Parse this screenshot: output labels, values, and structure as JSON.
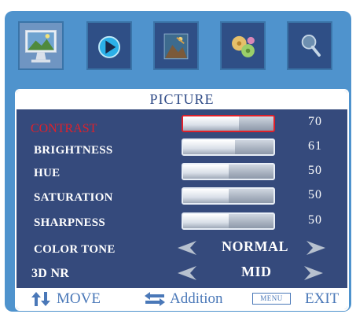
{
  "menu_title": "PICTURE",
  "tabs": [
    {
      "name": "picture-tab-icon"
    },
    {
      "name": "play-tab-icon"
    },
    {
      "name": "photo-tab-icon"
    },
    {
      "name": "settings-tab-icon"
    },
    {
      "name": "search-tab-icon"
    }
  ],
  "sliders": [
    {
      "label": "CONTRAST",
      "value": "70",
      "level": 0.62,
      "active": true
    },
    {
      "label": "BRIGHTNESS",
      "value": "61",
      "level": 0.57,
      "active": false
    },
    {
      "label": "HUE",
      "value": "50",
      "level": 0.5,
      "active": false
    },
    {
      "label": "SATURATION",
      "value": "50",
      "level": 0.5,
      "active": false
    },
    {
      "label": "SHARPNESS",
      "value": "50",
      "level": 0.5,
      "active": false
    }
  ],
  "selectors": [
    {
      "label": "COLOR TONE",
      "value": "NORMAL"
    },
    {
      "label": "3D NR",
      "value": "MID"
    }
  ],
  "footer": {
    "move": "MOVE",
    "addition": "Addition",
    "menu_key": "MENU",
    "exit": "EXIT"
  },
  "colors": {
    "frame": "#4f93cd",
    "panel": "#354a7c",
    "active": "#e0202a",
    "hint": "#4a78b8"
  }
}
